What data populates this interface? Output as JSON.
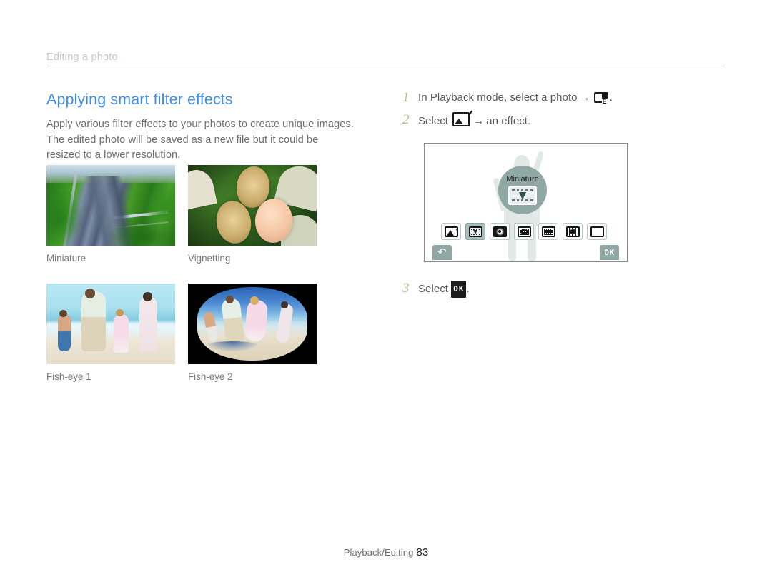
{
  "header": {
    "section_label": "Editing a photo"
  },
  "left": {
    "title": "Applying smart filter effects",
    "intro": "Apply various filter effects to your photos to create unique images. The edited photo will be saved as a new file but it could be resized to a lower resolution.",
    "samples": [
      {
        "caption": "Miniature",
        "art": "aerial-highway-green-trees"
      },
      {
        "caption": "Vignetting",
        "art": "three-faces-on-grass"
      },
      {
        "caption": "Fish-eye 1",
        "art": "family-running-on-beach"
      },
      {
        "caption": "Fish-eye 2",
        "art": "family-beach-fisheye-distorted"
      }
    ]
  },
  "right": {
    "steps": [
      {
        "num": "1",
        "text_before": "In Playback mode, select a photo",
        "arrow": "→",
        "icon": "edit-mode-icon",
        "text_after": "."
      },
      {
        "num": "2",
        "text_before": "Select",
        "arrow": "→",
        "icon": "smart-filter-icon",
        "text_after": "an effect."
      },
      {
        "num": "3",
        "text_before": "Select",
        "icon": "ok-button-icon",
        "ok_label": "OK",
        "text_after": "."
      }
    ],
    "screen_mock": {
      "selected_effect_label": "Miniature",
      "back_glyph": "↶",
      "ok_label": "OK",
      "filters": [
        {
          "name": "smart-filter-original-icon",
          "selected": false
        },
        {
          "name": "miniature-filter-icon",
          "selected": true
        },
        {
          "name": "vignetting-filter-icon",
          "selected": false
        },
        {
          "name": "fish-eye-1-filter-icon",
          "selected": false
        },
        {
          "name": "fish-eye-2-filter-icon",
          "selected": false
        },
        {
          "name": "classic-filter-icon",
          "selected": false
        },
        {
          "name": "none-filter-icon",
          "selected": false
        }
      ]
    }
  },
  "footer": {
    "section": "Playback/Editing",
    "page": "83"
  },
  "colors": {
    "title_blue": "#3d8ef0",
    "header_gray_green": "#c2cdc2",
    "step_number_green": "#b2c08c",
    "body_gray": "#6d6e70",
    "mock_teal": "#8fa8a4"
  }
}
